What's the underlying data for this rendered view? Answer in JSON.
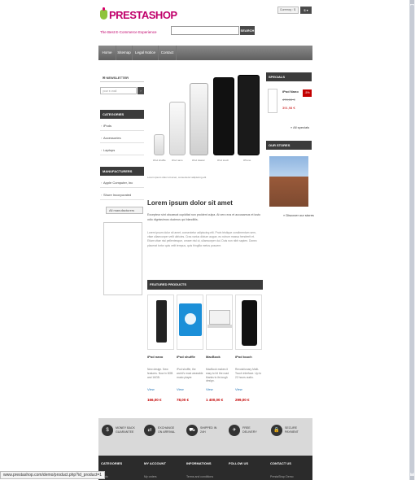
{
  "header": {
    "logo_text": "PRESTASHOP",
    "logo_tagline": "The Best E-Commerce Experience",
    "currency_label": "Currency : $",
    "cart_label": "$ ▾",
    "search_placeholder": "",
    "search_button": "SEARCH"
  },
  "nav": {
    "items": [
      "Home",
      "Sitemap",
      "Legal Notice",
      "Contact"
    ]
  },
  "left": {
    "newsletter_title": "NEWSLETTER",
    "newsletter_placeholder": "your e-mail",
    "newsletter_button": "›",
    "categories_title": "CATEGORIES",
    "categories": [
      "iPods",
      "Accessories",
      "Laptops"
    ],
    "manufacturers_title": "MANUFACTURERS",
    "manufacturers": [
      "Apple Computer, Inc",
      "Shure Incorporated"
    ],
    "manufacturer_select": "All manufacturers"
  },
  "center": {
    "hero_labels": [
      "iPod shuffle",
      "iPod nano",
      "iPod classic",
      "iPod touch",
      "iPhone"
    ],
    "hero_caption": "Lorem ipsum dolor sit amet, consectetur adipiscing elit",
    "title": "Lorem ipsum dolor sit amet",
    "lead": "Excepteur sint obcaecat cupiditat non proident culpa. At vero eos et accusamus et iusto odio dignissimos ducimus qui blanditiis.",
    "body": "Lorem ipsum dolor sit amet, consectetur adipiscing elit. Proin tristique condimentum sem, vitae ullamcorper velit ultricies. Cras varius dictum augue, eu rutrum massa hendrerit et. Etiam vitae nisi pellentesque, ornare nisl ut, ullamcorper dui. Duis non nibh sapien. Donec placerat tortor quis velit tempus, quis fringilla metus posuere.",
    "featured_title": "FEATURED PRODUCTS",
    "view_label": "View",
    "products": [
      {
        "name": "iPod nano",
        "desc": "New design. New features. Now in 8GB and 16GB.",
        "price": "166,00 €"
      },
      {
        "name": "iPod shuffle",
        "desc": "iPod shuffle, the world's most wearable music player.",
        "price": "78,00 €"
      },
      {
        "name": "MacBook",
        "desc": "MacBook makes it easy to hit the road thanks to its tough design.",
        "price": "1 400,00 €"
      },
      {
        "name": "iPod touch",
        "desc": "Revolutionary Multi-Touch interface. Up to 22 hours audio.",
        "price": "299,00 €"
      }
    ]
  },
  "right": {
    "specials_title": "SPECIALS",
    "special_name": "iPod Nano",
    "special_old": "474,00 €",
    "special_new": "391,98 €",
    "special_badge": "-5%",
    "all_specials": "» All specials",
    "stores_title": "OUR STORES",
    "discover": "» Discover our stores"
  },
  "reassurance": [
    {
      "icon": "money-icon",
      "glyph": "$",
      "text": "Money back guarantee"
    },
    {
      "icon": "exchange-icon",
      "glyph": "⇄",
      "text": "Exchange on arrival"
    },
    {
      "icon": "truck-icon",
      "glyph": "⛟",
      "text": "Shipped in 24h"
    },
    {
      "icon": "delivery-icon",
      "glyph": "✈",
      "text": "Free delivery"
    },
    {
      "icon": "lock-icon",
      "glyph": "🔒",
      "text": "Secure payment"
    }
  ],
  "footer": {
    "columns": [
      "CATEGORIES",
      "MY ACCOUNT",
      "INFORMATIONS",
      "FOLLOW US",
      "CONTACT US"
    ],
    "subs": [
      "iPods",
      "My orders",
      "Terms and conditions",
      "",
      "PrestaShop Demo"
    ]
  },
  "status": {
    "url": "www.prestashop.com/demo/product.php?id_product=1"
  },
  "colors": {
    "brand": "#c0006b",
    "accent_green": "#8fc33b",
    "dark_bar": "#3b3b3b",
    "price_red": "#c30000"
  }
}
